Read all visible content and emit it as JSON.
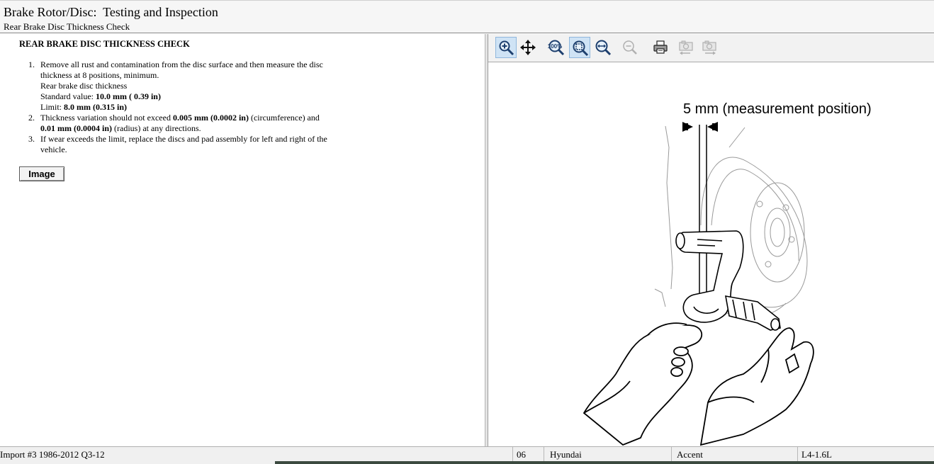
{
  "header": {
    "title": "Brake Rotor/Disc:  Testing and Inspection",
    "subtitle": "Rear Brake Disc Thickness Check"
  },
  "document": {
    "heading": "REAR BRAKE DISC THICKNESS CHECK",
    "steps": [
      {
        "num": "1.",
        "line1": "Remove all rust and contamination from the disc surface and then measure the disc",
        "line2": "thickness at 8 positions, minimum.",
        "line3": "Rear brake disc thickness",
        "std_prefix": "Standard value: ",
        "std_value": "10.0 mm ( 0.39 in)",
        "limit_prefix": "Limit: ",
        "limit_value": "8.0 mm (0.315 in)"
      },
      {
        "num": "2.",
        "text_a": "Thickness variation should not exceed ",
        "val_a": "0.005 mm (0.0002 in)",
        "text_b": " (circumference) and",
        "val_b": "0.01 mm (0.0004 in)",
        "text_c": " (radius) at any directions."
      },
      {
        "num": "3.",
        "line1": "If wear exceeds the limit, replace the discs and pad assembly for left and right of the",
        "line2": "vehicle."
      }
    ],
    "image_button": "Image"
  },
  "toolbar": {
    "buttons": [
      {
        "icon": "zoom-in-icon",
        "active": true
      },
      {
        "icon": "pan-icon",
        "active": false
      },
      {
        "icon": "zoom-100-icon",
        "label": "100%",
        "active": false
      },
      {
        "icon": "zoom-fit-icon",
        "active": true
      },
      {
        "icon": "zoom-width-icon",
        "active": false
      },
      {
        "icon": "zoom-out-icon",
        "active": false
      },
      {
        "icon": "print-icon",
        "active": false
      },
      {
        "icon": "previous-image-icon",
        "active": false
      },
      {
        "icon": "next-image-icon",
        "active": false
      }
    ]
  },
  "figure": {
    "label": "5 mm (measurement position)"
  },
  "statusbar": {
    "source": "Import #3 1986-2012 Q3-12",
    "year": "06",
    "make": "Hyundai",
    "model": "Accent",
    "engine": "L4-1.6L"
  },
  "colors": {
    "active_button": "#cfe3f5",
    "header_bg": "#f6f6f6",
    "status_bg": "#f0f0f0"
  }
}
